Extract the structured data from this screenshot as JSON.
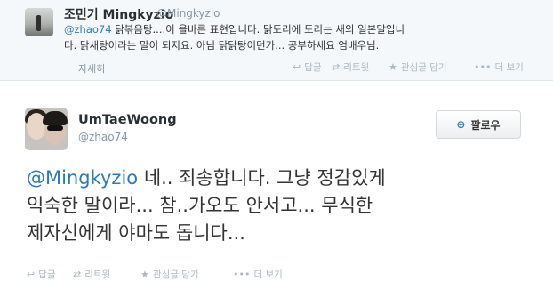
{
  "reply_tweet": {
    "name": "조민기",
    "username": "Mingkyzio",
    "handle": "@Mingkyzio",
    "mention": "@zhao74",
    "text_line1": " 닭볶음탕....이 올바른 표현입니다. 닭도리에 도리는 새의 일본말입니",
    "text_line2": "다. 닭새탕이라는 말이 되지요. 아님 닭닭탕이던가... 공부하세요 엄배우님.",
    "expand": "자세히",
    "actions": {
      "reply": "답글",
      "retweet": "리트윗",
      "favorite": "관심글 담기",
      "more": "더 보기"
    },
    "icons": {
      "reply": "reply-arrow-icon",
      "retweet": "retweet-icon",
      "favorite": "star-icon",
      "more": "ellipsis-icon"
    }
  },
  "main_tweet": {
    "name": "UmTaeWoong",
    "handle": "@zhao74",
    "follow_label": "팔로우",
    "follow_icon": "add-user-icon",
    "mention": "@Mingkyzio",
    "text_line1": " 네.. 죄송합니다.  그냥 정감있게",
    "text_line2": "익숙한 말이라... 참..가오도 안서고... 무식한",
    "text_line3": "제자신에게 야마도 돕니다...",
    "actions": {
      "reply": "답글",
      "retweet": "리트윗",
      "favorite": "관심글 담기",
      "more": "더 보기"
    }
  },
  "colors": {
    "link": "#2b7bb9",
    "muted": "#8899a6",
    "text": "#333333",
    "top_background": "#f5f8fa"
  }
}
